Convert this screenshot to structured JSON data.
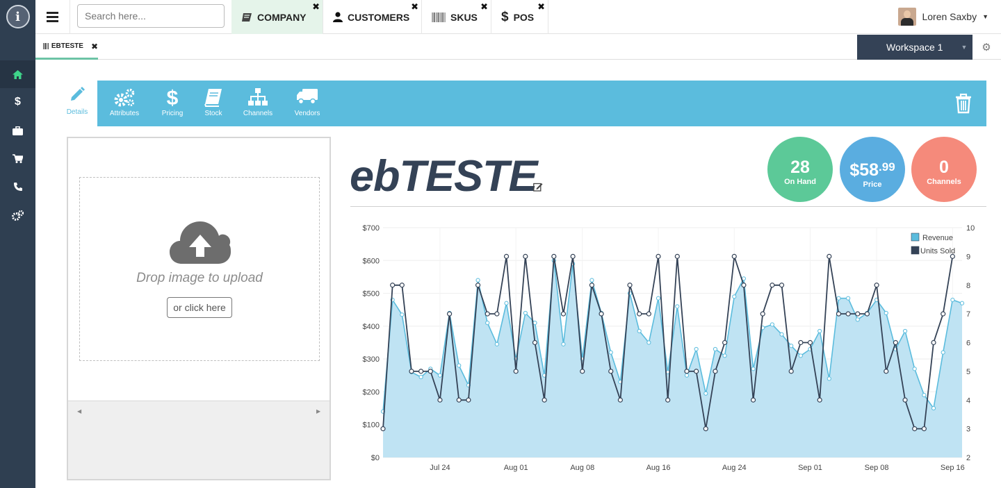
{
  "search": {
    "placeholder": "Search here..."
  },
  "top_tabs": [
    {
      "label": "COMPANY",
      "icon": "book-icon",
      "active": true
    },
    {
      "label": "CUSTOMERS",
      "icon": "user-icon"
    },
    {
      "label": "SKUS",
      "icon": "barcode-icon"
    },
    {
      "label": "POS",
      "icon": "dollar-icon"
    }
  ],
  "user": {
    "name": "Loren Saxby"
  },
  "doc_tab": {
    "label": "EBTESTE"
  },
  "workspace": {
    "label": "Workspace 1"
  },
  "sidebar": {
    "items": [
      "home-icon",
      "dollar-icon",
      "briefcase-icon",
      "cart-icon",
      "phone-icon",
      "gears-icon"
    ],
    "active_index": 0
  },
  "toolbar": {
    "details_label": "Details",
    "items": [
      {
        "label": "Attributes",
        "icon": "gears-icon"
      },
      {
        "label": "Pricing",
        "icon": "dollar-icon"
      },
      {
        "label": "Stock",
        "icon": "book-icon"
      },
      {
        "label": "Channels",
        "icon": "sitemap-icon"
      },
      {
        "label": "Vendors",
        "icon": "truck-icon"
      }
    ]
  },
  "upload": {
    "drop_text": "Drop image to upload",
    "button_label": "or click here"
  },
  "product": {
    "title": "ebTESTE"
  },
  "badges": [
    {
      "value": "28",
      "label": "On Hand",
      "color": "#5cc998"
    },
    {
      "value_main": "$58",
      "value_cents": ".99",
      "label": "Price",
      "color": "#5aade0"
    },
    {
      "value": "0",
      "label": "Channels",
      "color": "#f58a7b"
    }
  ],
  "colors": {
    "accent": "#5bbcdd",
    "rail": "#2f3f51",
    "dark": "#344256",
    "revenue_fill": "#bfe3f3",
    "revenue_line": "#5bbcdd",
    "units_line": "#344256"
  },
  "chart_data": {
    "type": "area",
    "x_start": "2015-07-18",
    "x_ticks": [
      "Jul 24",
      "Aug 01",
      "Aug 08",
      "Aug 16",
      "Aug 24",
      "Sep 01",
      "Sep 08",
      "Sep 16"
    ],
    "y_ticks": [
      "$0",
      "$100",
      "$200",
      "$300",
      "$400",
      "$500",
      "$600",
      "$700"
    ],
    "y2_ticks": [
      "2",
      "3",
      "4",
      "5",
      "6",
      "7",
      "8",
      "9",
      "10"
    ],
    "ylim": [
      0,
      700
    ],
    "y2lim": [
      2,
      10
    ],
    "legend_position": "top-right",
    "series": [
      {
        "name": "Revenue",
        "axis": "left",
        "values": [
          140,
          480,
          435,
          260,
          245,
          270,
          250,
          440,
          280,
          220,
          540,
          410,
          345,
          470,
          300,
          440,
          410,
          250,
          600,
          345,
          590,
          300,
          540,
          440,
          320,
          230,
          500,
          385,
          350,
          485,
          260,
          460,
          250,
          330,
          195,
          330,
          310,
          490,
          545,
          270,
          395,
          405,
          375,
          340,
          310,
          330,
          385,
          240,
          485,
          485,
          420,
          440,
          480,
          440,
          330,
          385,
          270,
          190,
          150,
          320,
          480,
          470
        ]
      },
      {
        "name": "Units Sold",
        "axis": "right",
        "values": [
          3,
          8,
          8,
          5,
          5,
          5,
          4,
          7,
          4,
          4,
          8,
          7,
          7,
          9,
          5,
          9,
          6,
          4,
          9,
          7,
          9,
          5,
          8,
          7,
          5,
          4,
          8,
          7,
          7,
          9,
          4,
          9,
          5,
          5,
          3,
          5,
          6,
          9,
          8,
          4,
          7,
          8,
          8,
          5,
          6,
          6,
          4,
          9,
          7,
          7,
          7,
          7,
          8,
          5,
          6,
          4,
          3,
          3,
          6,
          7,
          9
        ]
      }
    ]
  }
}
